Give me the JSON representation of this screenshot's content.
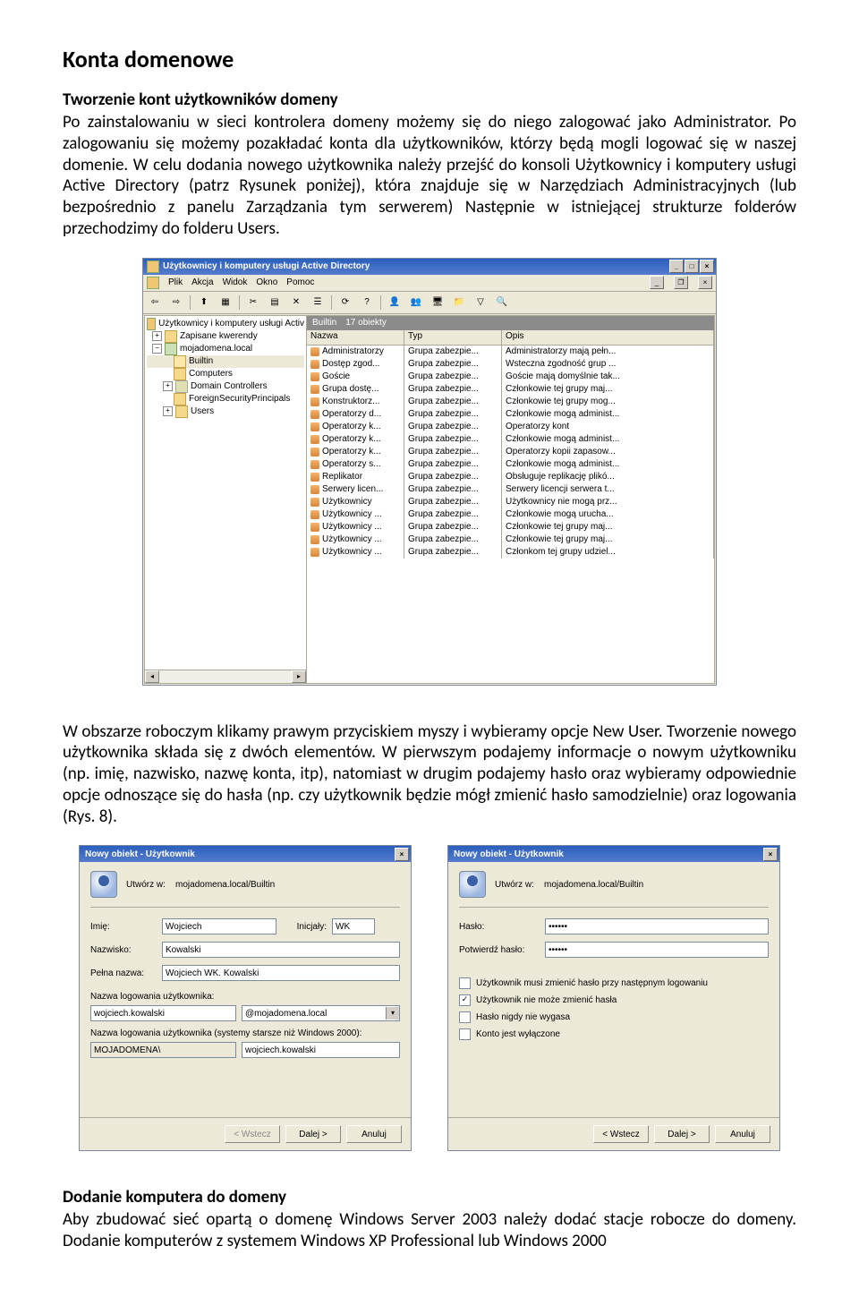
{
  "doc": {
    "h1": "Konta domenowe",
    "h2a": "Tworzenie kont użytkowników domeny",
    "p1": "Po zainstalowaniu w sieci kontrolera domeny możemy się do niego zalogować jako Administrator. Po zalogowaniu się możemy pozakładać konta dla użytkowników, którzy będą mogli logować się w naszej domenie. W celu dodania nowego użytkownika należy przejść do konsoli Użytkownicy i komputery usługi Active Directory (patrz Rysunek poniżej), która znajduje się w Narzędziach Administracyjnych (lub bezpośrednio z panelu Zarządzania tym serwerem) Następnie w istniejącej strukturze folderów przechodzimy do folderu Users.",
    "p2": "W obszarze roboczym klikamy prawym przyciskiem myszy i wybieramy opcje New User. Tworzenie nowego użytkownika składa się z dwóch elementów. W pierwszym podajemy informacje o nowym użytkowniku (np. imię, nazwisko, nazwę konta, itp), natomiast w drugim podajemy hasło oraz wybieramy odpowiednie opcje odnoszące się do hasła (np. czy użytkownik będzie mógł zmienić hasło samodzielnie) oraz logowania (Rys. 8).",
    "h2b": "Dodanie komputera do domeny",
    "p3": "Aby zbudować sieć opartą o domenę Windows Server 2003 należy dodać stacje robocze do domeny. Dodanie komputerów z systemem Windows XP Professional lub Windows 2000"
  },
  "ad": {
    "title": "Użytkownicy i komputery usługi Active Directory",
    "menu": {
      "plik": "Plik",
      "akcja": "Akcja",
      "widok": "Widok",
      "okno": "Okno",
      "pomoc": "Pomoc"
    },
    "tree": {
      "root": "Użytkownicy i komputery usługi Activ",
      "saved": "Zapisane kwerendy",
      "domain": "mojadomena.local",
      "builtin": "Builtin",
      "computers": "Computers",
      "dc": "Domain Controllers",
      "fsp": "ForeignSecurityPrincipals",
      "users": "Users"
    },
    "banner_folder": "Builtin",
    "banner_count": "17 obiekty",
    "headers": {
      "name": "Nazwa",
      "type": "Typ",
      "desc": "Opis"
    },
    "rows": [
      {
        "name": "Administratorzy",
        "type": "Grupa zabezpie...",
        "desc": "Administratorzy mają pełn..."
      },
      {
        "name": "Dostęp zgod...",
        "type": "Grupa zabezpie...",
        "desc": "Wsteczna zgodność grup ..."
      },
      {
        "name": "Goście",
        "type": "Grupa zabezpie...",
        "desc": "Goście mają domyślnie tak..."
      },
      {
        "name": "Grupa dostę...",
        "type": "Grupa zabezpie...",
        "desc": "Członkowie tej grupy maj..."
      },
      {
        "name": "Konstruktorz...",
        "type": "Grupa zabezpie...",
        "desc": "Członkowie tej grupy mog..."
      },
      {
        "name": "Operatorzy d...",
        "type": "Grupa zabezpie...",
        "desc": "Członkowie mogą administ..."
      },
      {
        "name": "Operatorzy k...",
        "type": "Grupa zabezpie...",
        "desc": "Operatorzy kont"
      },
      {
        "name": "Operatorzy k...",
        "type": "Grupa zabezpie...",
        "desc": "Członkowie mogą administ..."
      },
      {
        "name": "Operatorzy k...",
        "type": "Grupa zabezpie...",
        "desc": "Operatorzy kopii zapasow..."
      },
      {
        "name": "Operatorzy s...",
        "type": "Grupa zabezpie...",
        "desc": "Członkowie mogą administ..."
      },
      {
        "name": "Replikator",
        "type": "Grupa zabezpie...",
        "desc": "Obsługuje replikację plikó..."
      },
      {
        "name": "Serwery licen...",
        "type": "Grupa zabezpie...",
        "desc": "Serwery licencji serwera t..."
      },
      {
        "name": "Użytkownicy",
        "type": "Grupa zabezpie...",
        "desc": "Użytkownicy nie mogą prz..."
      },
      {
        "name": "Użytkownicy ...",
        "type": "Grupa zabezpie...",
        "desc": "Członkowie mogą urucha..."
      },
      {
        "name": "Użytkownicy ...",
        "type": "Grupa zabezpie...",
        "desc": "Członkowie tej grupy maj..."
      },
      {
        "name": "Użytkownicy ...",
        "type": "Grupa zabezpie...",
        "desc": "Członkowie tej grupy maj..."
      },
      {
        "name": "Użytkownicy ...",
        "type": "Grupa zabezpie...",
        "desc": "Członkom tej grupy udziel..."
      }
    ]
  },
  "dlg1": {
    "title": "Nowy obiekt - Użytkownik",
    "create_in_label": "Utwórz w:",
    "create_in_path": "mojadomena.local/Builtin",
    "imie_label": "Imię:",
    "imie_val": "Wojciech",
    "inicjaly_label": "Inicjały:",
    "inicjaly_val": "WK",
    "nazwisko_label": "Nazwisko:",
    "nazwisko_val": "Kowalski",
    "pelna_label": "Pełna nazwa:",
    "pelna_val": "Wojciech WK. Kowalski",
    "logon_label": "Nazwa logowania użytkownika:",
    "logon_val": "wojciech.kowalski",
    "logon_suffix": "@mojadomena.local",
    "logon2000_label": "Nazwa logowania użytkownika (systemy starsze niż Windows 2000):",
    "logon2000_domain": "MOJADOMENA\\",
    "logon2000_user": "wojciech.kowalski",
    "btn_back": "< Wstecz",
    "btn_next": "Dalej >",
    "btn_cancel": "Anuluj"
  },
  "dlg2": {
    "title": "Nowy obiekt - Użytkownik",
    "create_in_label": "Utwórz w:",
    "create_in_path": "mojadomena.local/Builtin",
    "haslo_label": "Hasło:",
    "haslo_val": "••••••",
    "potw_label": "Potwierdź hasło:",
    "potw_val": "••••••",
    "chk1": "Użytkownik musi zmienić hasło przy następnym logowaniu",
    "chk2": "Użytkownik nie może zmienić hasła",
    "chk3": "Hasło nigdy nie wygasa",
    "chk4": "Konto jest wyłączone",
    "btn_back": "< Wstecz",
    "btn_next": "Dalej >",
    "btn_cancel": "Anuluj"
  }
}
